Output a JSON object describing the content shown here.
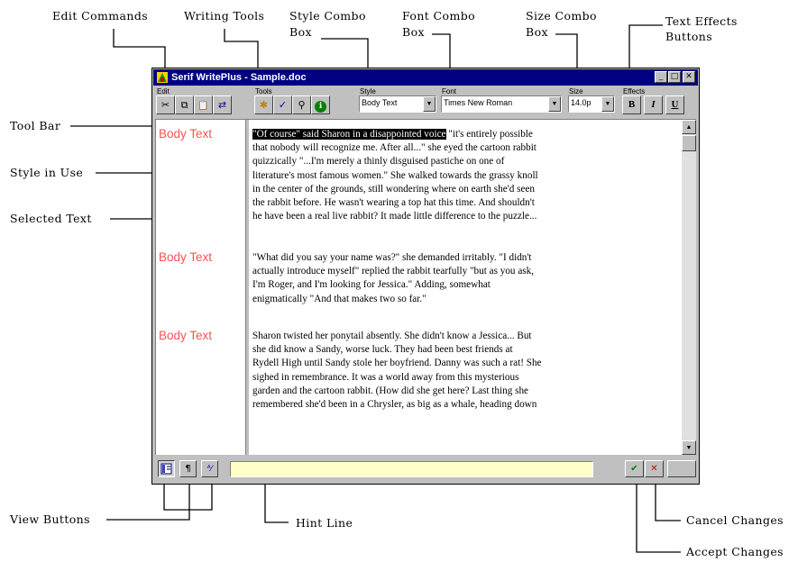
{
  "annotations": {
    "edit_commands": "Edit Commands",
    "writing_tools": "Writing Tools",
    "style_combo": [
      "Style Combo",
      "Box"
    ],
    "font_combo": [
      "Font Combo",
      "Box"
    ],
    "size_combo": [
      "Size Combo",
      "Box"
    ],
    "text_effects": [
      "Text Effects",
      "Buttons"
    ],
    "tool_bar": "Tool Bar",
    "style_in_use": "Style in Use",
    "selected_text": "Selected Text",
    "view_buttons": "View Buttons",
    "hint_line": "Hint Line",
    "cancel_changes": "Cancel Changes",
    "accept_changes": "Accept Changes"
  },
  "window": {
    "title": "Serif WritePlus - Sample.doc",
    "controls": {
      "minimize": "_",
      "maximize": "□",
      "close": "✕"
    }
  },
  "toolbar": {
    "edit": {
      "label": "Edit",
      "buttons": [
        {
          "icon": "scissors-icon",
          "glyph": "✂"
        },
        {
          "icon": "copy-icon",
          "glyph": "⧉"
        },
        {
          "icon": "paste-icon",
          "glyph": "📋"
        },
        {
          "icon": "replace-icon",
          "glyph": "⇄"
        }
      ]
    },
    "tools": {
      "label": "Tools",
      "buttons": [
        {
          "icon": "wizard-icon",
          "glyph": "✱"
        },
        {
          "icon": "spell-check-icon",
          "glyph": "✓"
        },
        {
          "icon": "find-icon",
          "glyph": "⚲"
        },
        {
          "icon": "info-icon",
          "glyph": "ℹ"
        }
      ]
    },
    "style": {
      "label": "Style",
      "value": "Body Text"
    },
    "font": {
      "label": "Font",
      "value": "Times New Roman"
    },
    "size": {
      "label": "Size",
      "value": "14.0p"
    },
    "effects": {
      "label": "Effects",
      "bold": "B",
      "italic": "I",
      "underline": "U"
    }
  },
  "document": {
    "style_name": "Body Text",
    "paragraphs": [
      {
        "style": "Body Text",
        "selected": "\"Of course\" said Sharon in a disappointed voice",
        "lines": [
          " \"it's entirely possible",
          "that nobody will recognize me. After all...\" she eyed the cartoon rabbit",
          "quizzically \"...I'm merely a thinly disguised pastiche on one of",
          "literature's most famous women.\" She walked towards the grassy knoll",
          "in the center of the grounds, still wondering where on earth she'd seen",
          "the rabbit before. He wasn't wearing a top hat this time. And shouldn't",
          "he have been a real live rabbit? It made little difference to the puzzle..."
        ]
      },
      {
        "style": "Body Text",
        "lines": [
          "\"What did you say your name was?\" she demanded irritably. \"I didn't",
          "actually introduce myself\" replied the rabbit tearfully \"but as you ask,",
          "I'm Roger, and I'm looking for Jessica.\" Adding, somewhat",
          "enigmatically \"And that makes two so far.\""
        ]
      },
      {
        "style": "Body Text",
        "lines": [
          "Sharon twisted her ponytail absently. She didn't know a Jessica... But",
          "she did know a Sandy, worse luck. They had been best friends at",
          "Rydell High until Sandy stole her boyfriend. Danny was such a rat! She",
          "sighed in remembrance. It was a world away from this mysterious",
          "garden and the cartoon rabbit. (How did she get here? Last thing she",
          "remembered she'd been in a Chrysler, as big as a whale, heading down"
        ]
      }
    ]
  },
  "statusbar": {
    "hint": "",
    "accept": "✔",
    "cancel": "✕"
  },
  "colors": {
    "title_bar": "#000080",
    "style_text": "#ff5050",
    "hint_bg": "#ffffc8",
    "accept": "#008000",
    "cancel": "#d00000"
  }
}
